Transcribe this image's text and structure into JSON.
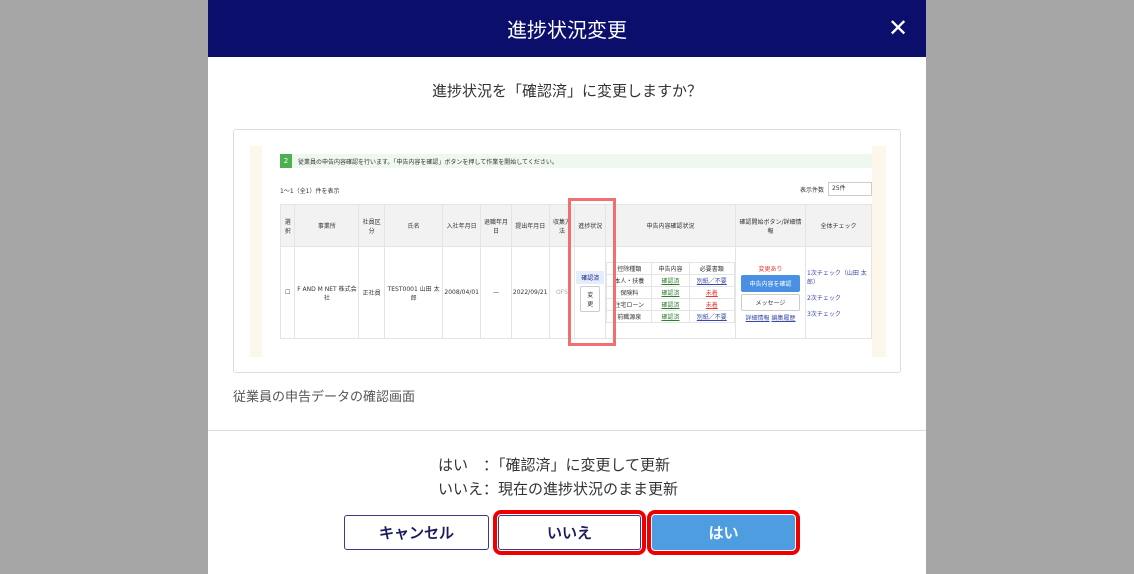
{
  "dialog": {
    "title": "進捗状況変更",
    "close_icon": "close-icon",
    "question": "進捗状況を「確認済」に変更しますか？",
    "caption": "従業員の申告データの確認画面",
    "legend": [
      "はい　：「確認済」に変更して更新",
      "いいえ：現在の進捗状況のまま更新"
    ],
    "buttons": {
      "cancel": "キャンセル",
      "no": "いいえ",
      "yes": "はい"
    },
    "colors": {
      "header": "#0b0f6b",
      "yes": "#4d9de0",
      "highlight": "#ee0000"
    }
  },
  "screenshot": {
    "step": "2",
    "banner": "従業員の申告内容確認を行います。「申告内容を確認」ボタンを押して作業を開始してください。",
    "count": "1〜1（全1）件を表示",
    "per_page_label": "表示件数",
    "per_page": "25件",
    "headers": [
      "選択",
      "事業所",
      "社員区分",
      "氏名",
      "入社年月日",
      "退職年月日",
      "提出年月日",
      "収集方法",
      "進捗状況",
      "申告内容確認状況",
      "確認開始ボタン/詳細情報",
      "全体チェック"
    ],
    "row": {
      "office": "F AND M NET 株式会社",
      "type": "正社員",
      "name": "TEST0001 山田 太郎",
      "join": "2008/04/01",
      "leave": "—",
      "submit": "2022/09/21",
      "method": "OFS",
      "status": "確認済",
      "change": "変更",
      "sub_headers": [
        "控除種類",
        "申告内容",
        "必要書類"
      ],
      "sub_rows": [
        [
          "本人・扶養",
          "確認済",
          "別紙／不要"
        ],
        [
          "保険料",
          "確認済",
          "未着"
        ],
        [
          "住宅ローン",
          "確認済",
          "未着"
        ],
        [
          "前職源泉",
          "確認済",
          "別紙／不要"
        ]
      ],
      "changed": "変更あり",
      "confirm_btn": "申告内容を確認",
      "message_btn": "メッセージ",
      "links": [
        "詳細情報",
        "編集履歴"
      ],
      "checks": [
        "1次チェック（山田 太郎）",
        "2次チェック",
        "3次チェック"
      ]
    }
  }
}
